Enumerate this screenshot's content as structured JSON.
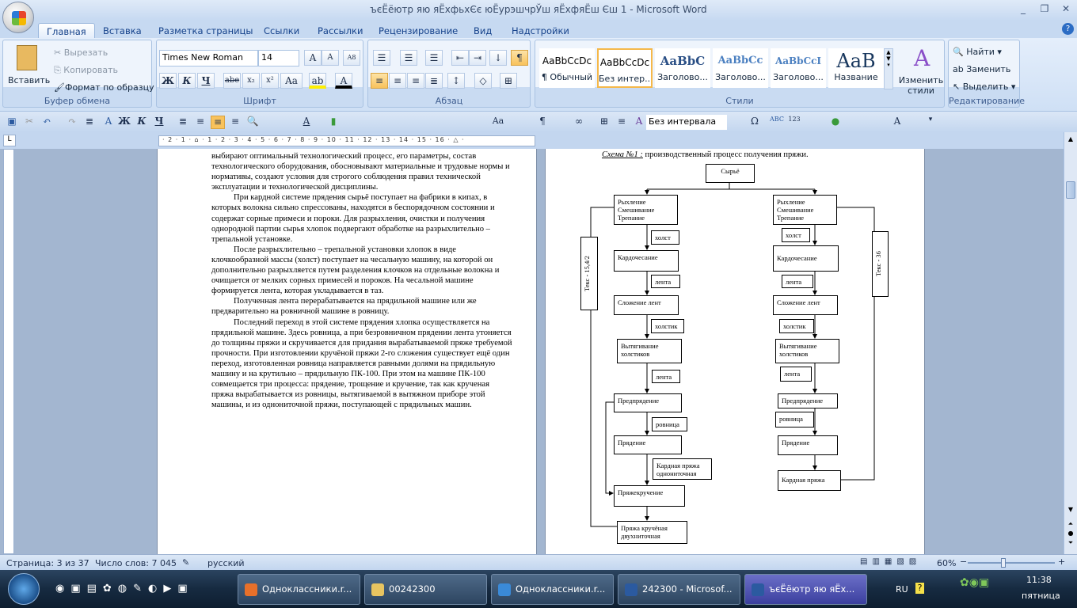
{
  "window": {
    "title": "ъєЁёютр  яю яЁхфьхЄє юЁурэшчрЎш  яЁхфяЁш Єш 1 - Microsoft Word"
  },
  "tabs": [
    "Главная",
    "Вставка",
    "Разметка страницы",
    "Ссылки",
    "Рассылки",
    "Рецензирование",
    "Вид",
    "Надстройки"
  ],
  "clipboard": {
    "paste": "Вставить",
    "cut": "Вырезать",
    "copy": "Копировать",
    "format_painter": "Формат по образцу",
    "label": "Буфер обмена"
  },
  "font": {
    "name": "Times New Roman",
    "size": "14",
    "label": "Шрифт",
    "bold": "Ж",
    "italic": "К",
    "underline": "Ч",
    "strike": "abe",
    "sub": "x₂",
    "sup": "x²",
    "case": "Aa"
  },
  "paragraph": {
    "label": "Абзац"
  },
  "styles": {
    "label": "Стили",
    "items": [
      {
        "sample": "AaBbCcDc",
        "name": "¶ Обычный"
      },
      {
        "sample": "AaBbCcDc",
        "name": "Без интер..."
      },
      {
        "sample": "AaBbC",
        "name": "Заголово..."
      },
      {
        "sample": "AaBbCc",
        "name": "Заголово..."
      },
      {
        "sample": "AaBbCcI",
        "name": "Заголово..."
      },
      {
        "sample": "AaB",
        "name": "Название"
      }
    ],
    "change": "Изменить стили"
  },
  "editing": {
    "label": "Редактирование",
    "find": "Найти",
    "replace": "Заменить",
    "select": "Выделить"
  },
  "qat": {
    "style_value": "Без интервала"
  },
  "ruler": {
    "ticks": "· 2 · 1 · ⌂ · 1 · 2 · 3 · 4 · 5 · 6 · 7 · 8 · 9 · 10 · 11 · 12 · 13 · 14 · 15 · 16 · △ ·"
  },
  "page1": {
    "paragraphs": [
      "выбирают оптимальный технологический процесс, его параметры, состав технологического оборудования, обосновывают материальные и трудовые нормы и нормативы, создают условия для строгого соблюдения правил технической эксплуатации и технологической дисциплины.",
      "При кардной системе прядения сырьё поступает на фабрики в кипах, в которых волокна сильно спрессованы, находятся в беспорядочном состоянии и содержат сорные примеси и пороки. Для разрыхления, очистки и получения однородной партии сырья хлопок подвергают обработке на разрыхлительно – трепальной установке.",
      "После разрыхлительно – трепальной установки хлопок в виде клочкообразной массы (холст) поступает на чесальную машину, на которой он дополнительно разрыхляется путем разделения клочков на отдельные волокна и очищается от мелких сорных примесей и пороков. На чесальной машине формируется лента, которая укладывается в таз.",
      "Полученная лента перерабатывается на прядильной машине или же предварительно на ровничной машине в ровницу.",
      "Последний переход в этой системе прядения хлопка осуществляется на прядильной машине. Здесь ровница, а при безровничном прядении лента утоняется до толщины пряжи и скручивается для придания вырабатываемой пряже требуемой прочности. При изготовлении кручёной пряжи 2-го сложения существует ещё один переход, изготовленная ровница направляется равными долями на прядильную машину и на крутильно – прядильную ПК-100. При этом на машине ПК-100 совмещается три процесса: прядение, трощение и кручение, так как крученая пряжа вырабатывается из ровницы, вытягиваемой в вытяжном приборе этой машины, и из однониточной пряжи, поступающей с прядильных машин."
    ]
  },
  "page2": {
    "caption_label": "Схема №1 :",
    "caption_text": " производственный процесс получения пряжи.",
    "root": "Сырьё",
    "left": {
      "b1": "Рыхление Смешивание Трепание",
      "l1": "холст",
      "b2": "Кардочесание",
      "l2": "лента",
      "b3": "Сложение лент",
      "l3": "холстик",
      "b4": "Вытягивание холстиков",
      "l4": "лента",
      "b5": "Предпрядение",
      "l5": "ровница",
      "b6": "Прядение",
      "l6": "Кардная пряжа однониточная",
      "b7": "Пряжекручение",
      "b8": "Пряжа кручёная двухниточная",
      "side": "Текс - 15,4/2"
    },
    "right": {
      "b1": "Рыхление Смешивание Трепание",
      "l1": "холст",
      "b2": "Кардочесание",
      "l2": "лента",
      "b3": "Сложение лент",
      "l3": "холстик",
      "b4": "Вытягивание холстиков",
      "l4": "лента",
      "b5": "Предпрядение",
      "l5": "ровница",
      "b6": "Прядение",
      "b7": "Кардная пряжа",
      "side": "Текс - 36"
    }
  },
  "status": {
    "page": "Страница: 3 из 37",
    "words": "Число слов: 7 045",
    "lang": "русский",
    "zoom": "60%",
    "zoom_value": 60
  },
  "taskbar": {
    "tasks": [
      "Одноклассники.r...",
      "00242300",
      "Одноклассники.r...",
      "242300 - Microsof...",
      "ъєЁёютр  яю яЁх..."
    ],
    "lang": "RU",
    "time": "11:38",
    "day": "пятница"
  }
}
